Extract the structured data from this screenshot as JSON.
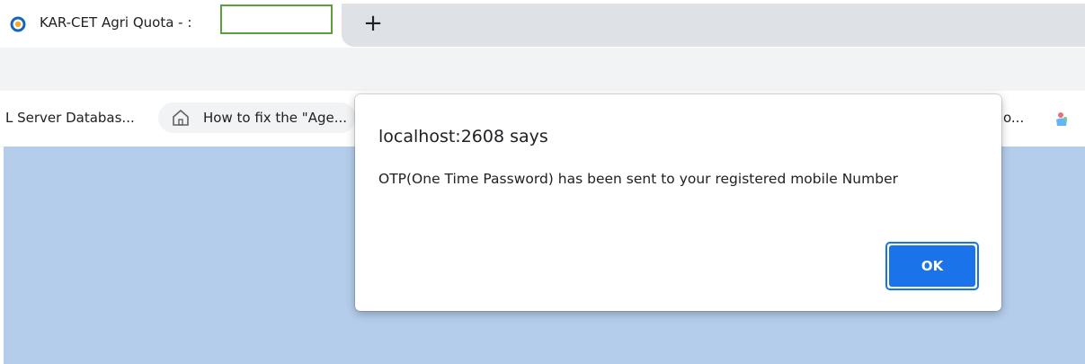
{
  "tab": {
    "title": "KAR-CET Agri Quota - :",
    "new_tab_label": "+"
  },
  "bookmarks": {
    "items": [
      {
        "label": "L Server Databas..."
      },
      {
        "label": "How to fix the \"Age..."
      },
      {
        "label": "o..."
      }
    ]
  },
  "dialog": {
    "title": "localhost:2608 says",
    "message": "OTP(One Time Password) has been sent to your registered mobile Number",
    "ok_label": "OK"
  },
  "colors": {
    "page_background": "#b4cdeb",
    "accent": "#1a73e8",
    "tabstrip_background": "#dee1e6",
    "toolbar_background": "#f1f3f4"
  },
  "icons": {
    "favicon": "site-favicon",
    "bookmark_2": "home-icon",
    "bookmark_4": "bookmark-favicon"
  }
}
